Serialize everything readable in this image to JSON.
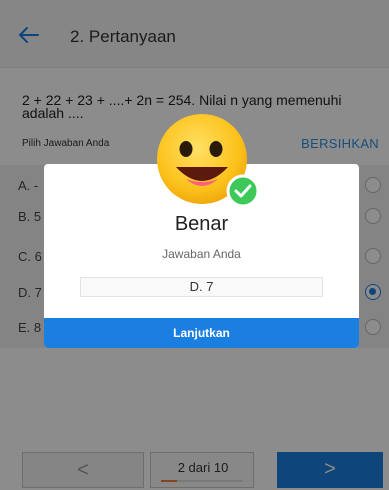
{
  "header": {
    "title": "2. Pertanyaan",
    "back_icon": "arrow-left-icon"
  },
  "question": {
    "text": "2 + 22 + 23 + ....+ 2n = 254. Nilai n yang memenuhi adalah ...."
  },
  "answer_section": {
    "label": "Pilih Jawaban Anda",
    "clear_label": "BERSIHKAN"
  },
  "options": [
    {
      "label": "A. -",
      "selected": false
    },
    {
      "label": "B. 5",
      "selected": false
    },
    {
      "label": "C. 6",
      "selected": false
    },
    {
      "label": "D. 7",
      "selected": true
    },
    {
      "label": "E. 8",
      "selected": false
    }
  ],
  "footer": {
    "prev_label": "<",
    "page_indicator": "2 dari 10",
    "progress": 0.2,
    "next_label": ">"
  },
  "dialog": {
    "title": "Benar",
    "subtitle": "Jawaban Anda",
    "answer": "D. 7",
    "continue_label": "Lanjutkan",
    "emoji_icon": "smiley-face-icon",
    "check_icon": "check-circle-icon"
  },
  "colors": {
    "accent": "#1a7fe0",
    "link": "#2f8ee0",
    "success": "#3cc95a",
    "emoji": "#fbc02d",
    "progress": "#f07c3c"
  }
}
